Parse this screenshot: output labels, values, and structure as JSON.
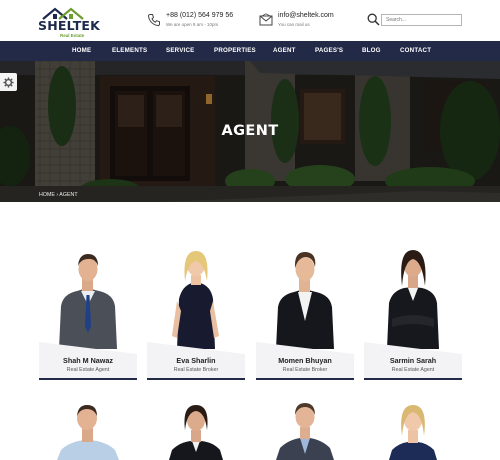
{
  "header": {
    "brand": "SHELTEK",
    "tagline": "Real Estate",
    "phone": {
      "number": "+88 (012) 564 979 56",
      "hours": "We are open 9 am - 10pm"
    },
    "email": {
      "address": "info@sheltek.com",
      "note": "You can mail us"
    },
    "search": {
      "placeholder": "Search..."
    }
  },
  "nav": [
    "HOME",
    "ELEMENTS",
    "SERVICE",
    "PROPERTIES",
    "AGENT",
    "PAGES'S",
    "BLOG",
    "CONTACT"
  ],
  "hero": {
    "title": "AGENT",
    "breadcrumb": "HOME  ›  AGENT"
  },
  "agents": [
    {
      "name": "Shah M Nawaz",
      "role": "Real Estate Agent"
    },
    {
      "name": "Eva Sharlin",
      "role": "Real Estate Broker"
    },
    {
      "name": "Momen Bhuyan",
      "role": "Real Estate Broker"
    },
    {
      "name": "Sarmin Sarah",
      "role": "Real Estate Agent"
    }
  ],
  "colors": {
    "navy": "#232a48",
    "accent_green": "#6b9e2f",
    "plate": "#f3f3f5"
  },
  "icons": [
    "phone-icon",
    "mail-icon",
    "search-icon",
    "gear-icon"
  ]
}
